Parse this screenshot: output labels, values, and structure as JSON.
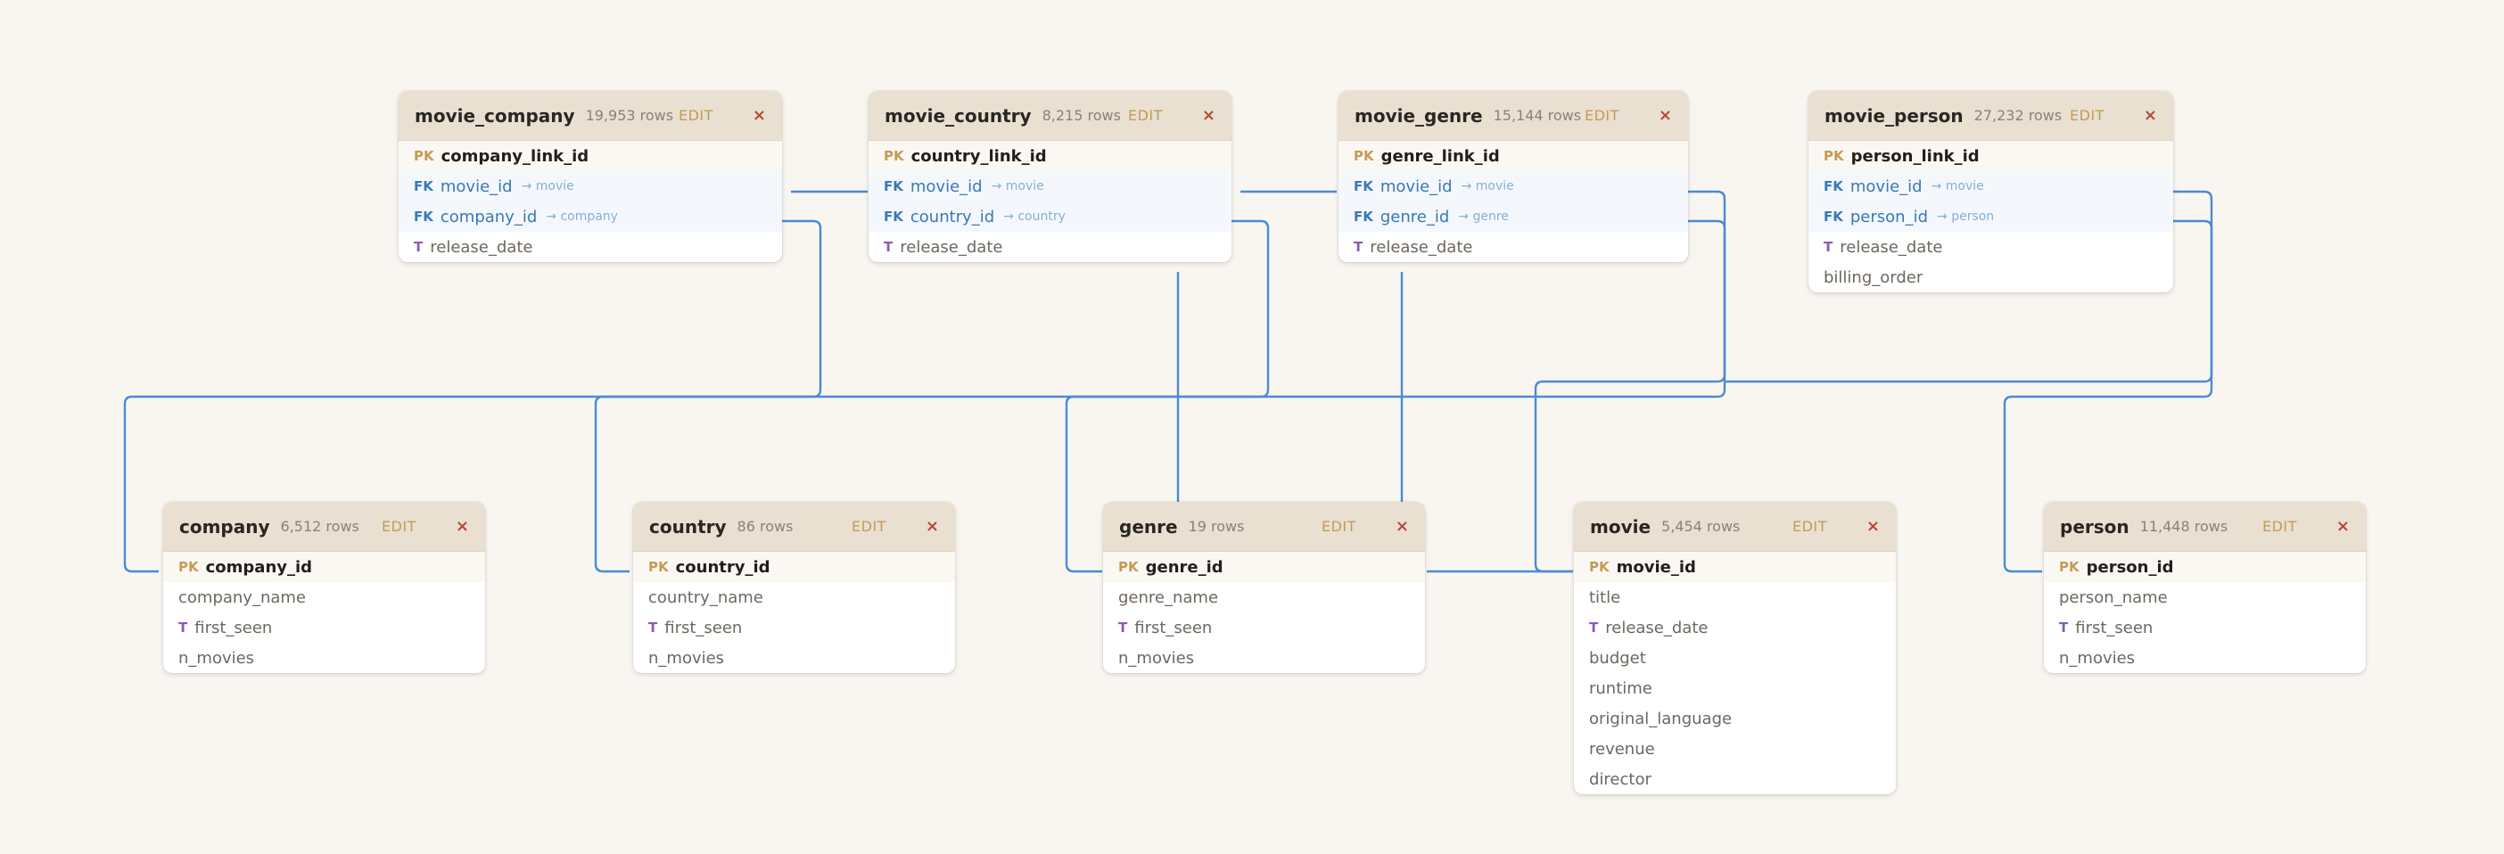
{
  "colors": {
    "link": "#4a8bd2",
    "header": "#e9e0d2",
    "canvas": "#f9f6f1"
  },
  "tables": {
    "movie_company": {
      "name": "movie_company",
      "rows": "19,953 rows",
      "edit": "EDIT",
      "close": "×",
      "columns": [
        {
          "tag": "PK",
          "name": "company_link_id",
          "ref": ""
        },
        {
          "tag": "FK",
          "name": "movie_id",
          "ref": "→ movie"
        },
        {
          "tag": "FK",
          "name": "company_id",
          "ref": "→ company"
        },
        {
          "tag": "T",
          "name": "release_date",
          "ref": ""
        }
      ]
    },
    "movie_country": {
      "name": "movie_country",
      "rows": "8,215 rows",
      "edit": "EDIT",
      "close": "×",
      "columns": [
        {
          "tag": "PK",
          "name": "country_link_id",
          "ref": ""
        },
        {
          "tag": "FK",
          "name": "movie_id",
          "ref": "→ movie"
        },
        {
          "tag": "FK",
          "name": "country_id",
          "ref": "→ country"
        },
        {
          "tag": "T",
          "name": "release_date",
          "ref": ""
        }
      ]
    },
    "movie_genre": {
      "name": "movie_genre",
      "rows": "15,144 rows",
      "edit": "EDIT",
      "close": "×",
      "columns": [
        {
          "tag": "PK",
          "name": "genre_link_id",
          "ref": ""
        },
        {
          "tag": "FK",
          "name": "movie_id",
          "ref": "→ movie"
        },
        {
          "tag": "FK",
          "name": "genre_id",
          "ref": "→ genre"
        },
        {
          "tag": "T",
          "name": "release_date",
          "ref": ""
        }
      ]
    },
    "movie_person": {
      "name": "movie_person",
      "rows": "27,232 rows",
      "edit": "EDIT",
      "close": "×",
      "columns": [
        {
          "tag": "PK",
          "name": "person_link_id",
          "ref": ""
        },
        {
          "tag": "FK",
          "name": "movie_id",
          "ref": "→ movie"
        },
        {
          "tag": "FK",
          "name": "person_id",
          "ref": "→ person"
        },
        {
          "tag": "T",
          "name": "release_date",
          "ref": ""
        },
        {
          "tag": "",
          "name": "billing_order",
          "ref": ""
        }
      ]
    },
    "company": {
      "name": "company",
      "rows": "6,512 rows",
      "edit": "EDIT",
      "close": "×",
      "columns": [
        {
          "tag": "PK",
          "name": "company_id",
          "ref": ""
        },
        {
          "tag": "",
          "name": "company_name",
          "ref": ""
        },
        {
          "tag": "T",
          "name": "first_seen",
          "ref": ""
        },
        {
          "tag": "",
          "name": "n_movies",
          "ref": ""
        }
      ]
    },
    "country": {
      "name": "country",
      "rows": "86 rows",
      "edit": "EDIT",
      "close": "×",
      "columns": [
        {
          "tag": "PK",
          "name": "country_id",
          "ref": ""
        },
        {
          "tag": "",
          "name": "country_name",
          "ref": ""
        },
        {
          "tag": "T",
          "name": "first_seen",
          "ref": ""
        },
        {
          "tag": "",
          "name": "n_movies",
          "ref": ""
        }
      ]
    },
    "genre": {
      "name": "genre",
      "rows": "19 rows",
      "edit": "EDIT",
      "close": "×",
      "columns": [
        {
          "tag": "PK",
          "name": "genre_id",
          "ref": ""
        },
        {
          "tag": "",
          "name": "genre_name",
          "ref": ""
        },
        {
          "tag": "T",
          "name": "first_seen",
          "ref": ""
        },
        {
          "tag": "",
          "name": "n_movies",
          "ref": ""
        }
      ]
    },
    "movie": {
      "name": "movie",
      "rows": "5,454 rows",
      "edit": "EDIT",
      "close": "×",
      "columns": [
        {
          "tag": "PK",
          "name": "movie_id",
          "ref": ""
        },
        {
          "tag": "",
          "name": "title",
          "ref": ""
        },
        {
          "tag": "T",
          "name": "release_date",
          "ref": ""
        },
        {
          "tag": "",
          "name": "budget",
          "ref": ""
        },
        {
          "tag": "",
          "name": "runtime",
          "ref": ""
        },
        {
          "tag": "",
          "name": "original_language",
          "ref": ""
        },
        {
          "tag": "",
          "name": "revenue",
          "ref": ""
        },
        {
          "tag": "",
          "name": "director",
          "ref": ""
        }
      ]
    },
    "person": {
      "name": "person",
      "rows": "11,448 rows",
      "edit": "EDIT",
      "close": "×",
      "columns": [
        {
          "tag": "PK",
          "name": "person_id",
          "ref": ""
        },
        {
          "tag": "",
          "name": "person_name",
          "ref": ""
        },
        {
          "tag": "T",
          "name": "first_seen",
          "ref": ""
        },
        {
          "tag": "",
          "name": "n_movies",
          "ref": ""
        }
      ]
    }
  }
}
